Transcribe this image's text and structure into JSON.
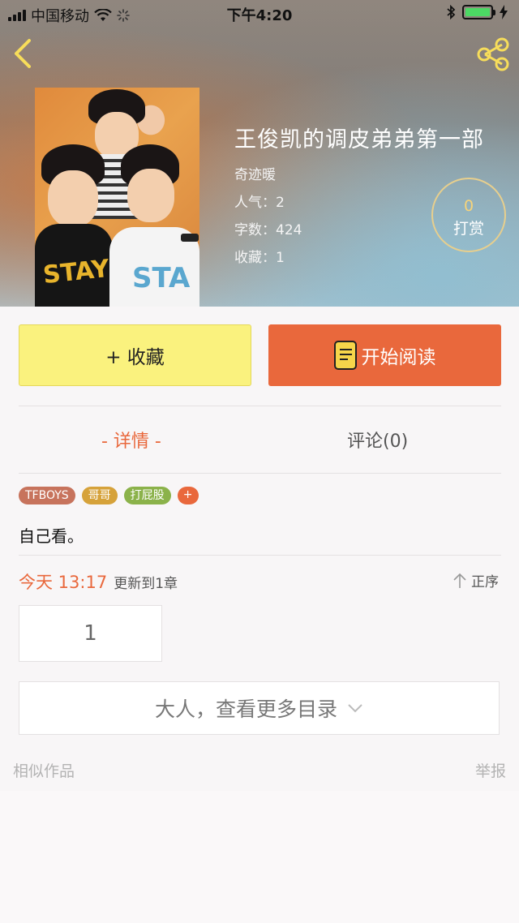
{
  "status_bar": {
    "carrier": "中国移动",
    "time": "下午4:20"
  },
  "header": {
    "back_icon": "chevron-left-icon",
    "share_icon": "share-icon"
  },
  "book": {
    "cover_text": "STAY",
    "title": "王俊凯的调皮弟弟第一部",
    "author": "奇迹暖",
    "popularity": "人气：2",
    "word_count": "字数：424",
    "favorites": "收藏：1"
  },
  "reward": {
    "count": "0",
    "label": "打赏"
  },
  "actions": {
    "favorite_label": "+ 收藏",
    "read_label": "开始阅读"
  },
  "tabs": {
    "detail": "- 详情 -",
    "comments": "评论(0)"
  },
  "tags": [
    {
      "label": "TFBOYS",
      "color": "#c7735c"
    },
    {
      "label": "哥哥",
      "color": "#d6a23a"
    },
    {
      "label": "打屁股",
      "color": "#8bb24a"
    }
  ],
  "tag_add": "+",
  "description": "自己看。",
  "update": {
    "when": "今天 13:17",
    "info": "更新到1章"
  },
  "order_label": "正序",
  "chapters": [
    "1"
  ],
  "more_catalog": "大人，查看更多目录",
  "similar_works": "相似作品",
  "report": "举报",
  "colors": {
    "accent": "#e9683c",
    "favorite_bg": "#faf27e",
    "reward_ring": "#e8cf8d"
  }
}
